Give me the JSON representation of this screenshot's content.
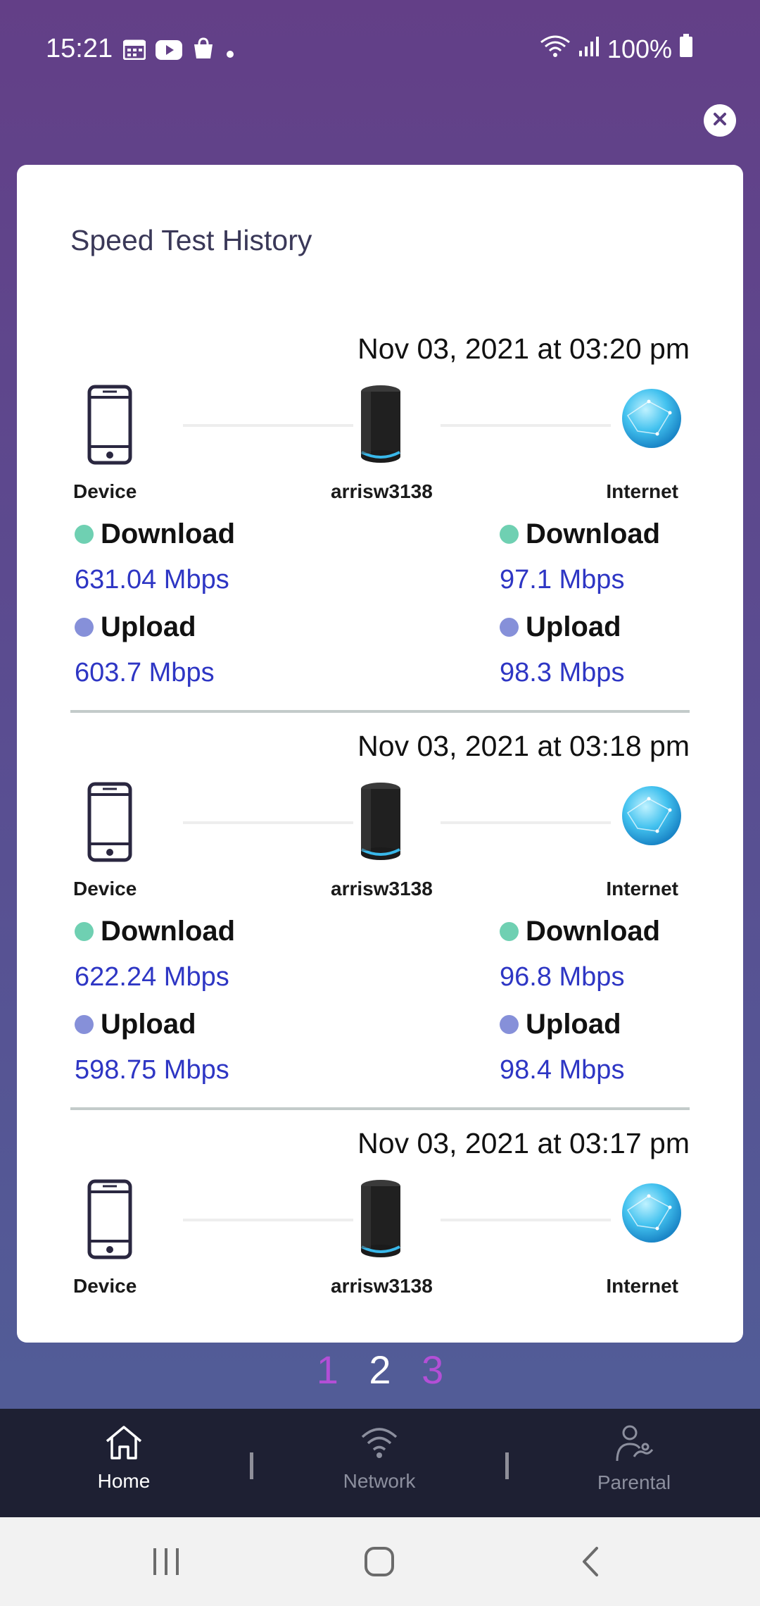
{
  "status_bar": {
    "time": "15:21",
    "battery": "100%",
    "left_icons": [
      "calendar-icon",
      "youtube-icon",
      "shopping-bag-icon",
      "dot-icon"
    ],
    "right_icons": [
      "wifi-icon",
      "signal-icon",
      "battery-icon"
    ]
  },
  "modal": {
    "title": "Speed Test History",
    "close_icon": "close-icon"
  },
  "labels": {
    "device": "Device",
    "gateway": "arrisw3138",
    "internet": "Internet",
    "download": "Download",
    "upload": "Upload"
  },
  "entries": [
    {
      "date": "Nov 03, 2021 at 03:20 pm",
      "device_download": "631.04  Mbps",
      "device_upload": "603.7  Mbps",
      "internet_download": "97.1  Mbps",
      "internet_upload": "98.3  Mbps"
    },
    {
      "date": "Nov 03, 2021 at 03:18 pm",
      "device_download": "622.24  Mbps",
      "device_upload": "598.75  Mbps",
      "internet_download": "96.8  Mbps",
      "internet_upload": "98.4  Mbps"
    },
    {
      "date": "Nov 03, 2021 at 03:17 pm"
    }
  ],
  "pagination": {
    "pages": [
      "1",
      "2",
      "3"
    ],
    "current": "2",
    "active_color": "#ffffff",
    "inactive_color": "#b34fd6"
  },
  "colors": {
    "download_dot": "#6fd0b2",
    "upload_dot": "#8690d9",
    "value_text": "#2e36c4"
  },
  "bottom_nav": {
    "items": [
      {
        "label": "Home",
        "icon": "home-icon",
        "active": true
      },
      {
        "label": "Network",
        "icon": "wifi-icon",
        "active": false
      },
      {
        "label": "Parental",
        "icon": "parental-icon",
        "active": false
      }
    ]
  },
  "system_nav": {
    "icons": [
      "recent-apps-icon",
      "home-circle-icon",
      "back-icon"
    ]
  }
}
